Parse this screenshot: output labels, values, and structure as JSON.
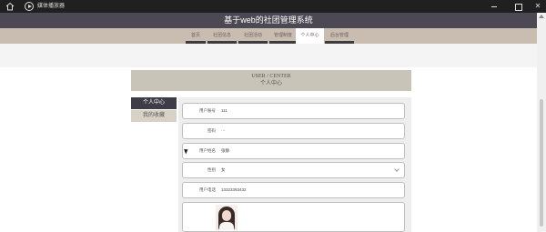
{
  "window": {
    "title": "媒体播放器"
  },
  "site": {
    "title": "基于web的社团管理系统"
  },
  "nav": {
    "items": [
      {
        "label": "首页",
        "active": false
      },
      {
        "label": "社团信息",
        "active": false
      },
      {
        "label": "社团活动",
        "active": false
      },
      {
        "label": "管理制度",
        "active": false
      },
      {
        "label": "个人中心",
        "active": true
      },
      {
        "label": "后台管理",
        "active": false
      }
    ]
  },
  "section": {
    "title_en": "USER / CENTER",
    "title_cn": "个人中心"
  },
  "side_menu": {
    "items": [
      "个人中心",
      "我的收藏"
    ]
  },
  "form": {
    "fields": [
      {
        "label": "用户账号",
        "value": "111"
      },
      {
        "label": "密码",
        "value": "···"
      },
      {
        "label": "用户姓名",
        "value": "张静"
      },
      {
        "label": "性别",
        "value": "女"
      },
      {
        "label": "用户电话",
        "value": "13323393432"
      }
    ]
  },
  "colors": {
    "header": "#4c4854",
    "nav": "#c9bdb2",
    "accent": "#3f3b47"
  }
}
